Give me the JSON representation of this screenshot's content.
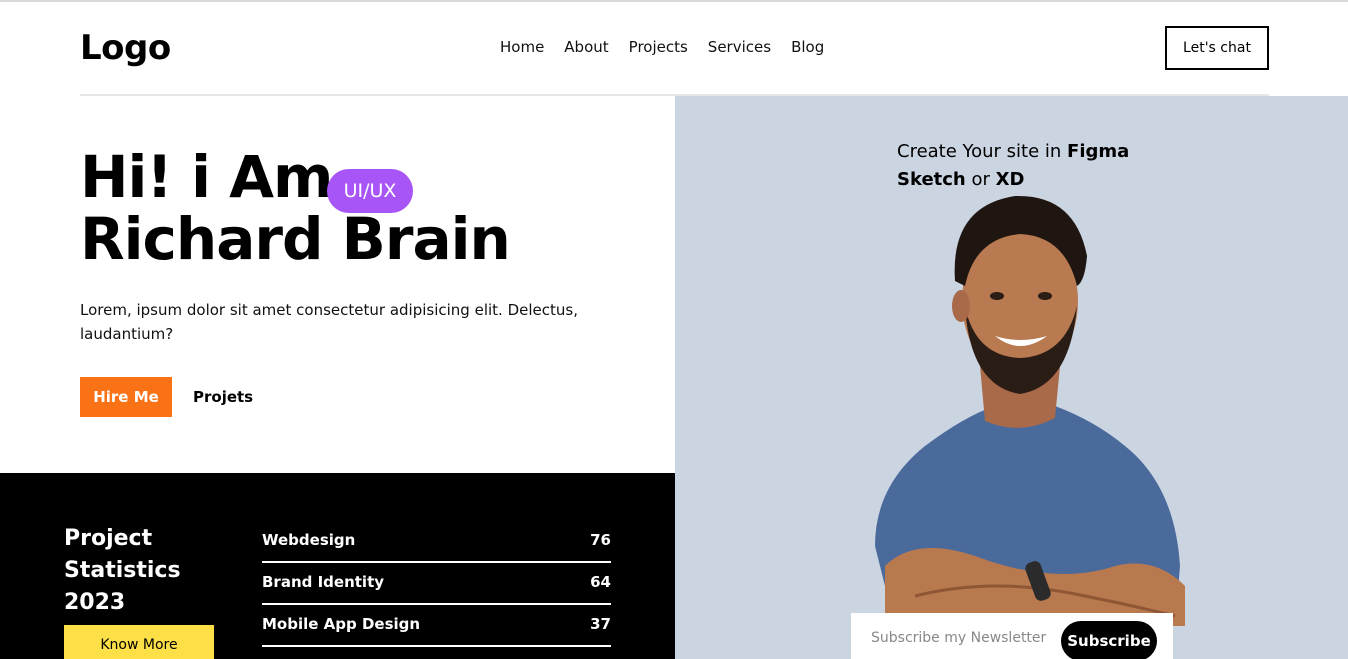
{
  "header": {
    "logo": "Logo",
    "nav": [
      "Home",
      "About",
      "Projects",
      "Services",
      "Blog"
    ],
    "cta": "Let's chat"
  },
  "hero": {
    "greeting": "Hi! i Am",
    "name": "Richard Brain",
    "badge": "UI/UX",
    "description": "Lorem, ipsum dolor sit amet consectetur adipisicing elit. Delectus, laudantium?",
    "primary_button": "Hire Me",
    "secondary_link": "Projets"
  },
  "promo": {
    "line1_prefix": "Create Your site in ",
    "line1_bold": "Figma",
    "line2_bold1": "Sketch",
    "line2_mid": " or ",
    "line2_bold2": "XD"
  },
  "stats": {
    "title_line1": "Project",
    "title_line2": "Statistics",
    "title_line3": "2023",
    "button": "Know More",
    "rows": [
      {
        "label": "Webdesign",
        "value": "76"
      },
      {
        "label": "Brand Identity",
        "value": "64"
      },
      {
        "label": "Mobile App Design",
        "value": "37"
      }
    ]
  },
  "newsletter": {
    "placeholder": "Subscribe my Newsletter",
    "button": "Subscribe"
  },
  "colors": {
    "accent_orange": "#f97316",
    "badge_purple": "#a855f7",
    "hero_panel": "#cbd4e1",
    "button_yellow": "#fde047"
  }
}
